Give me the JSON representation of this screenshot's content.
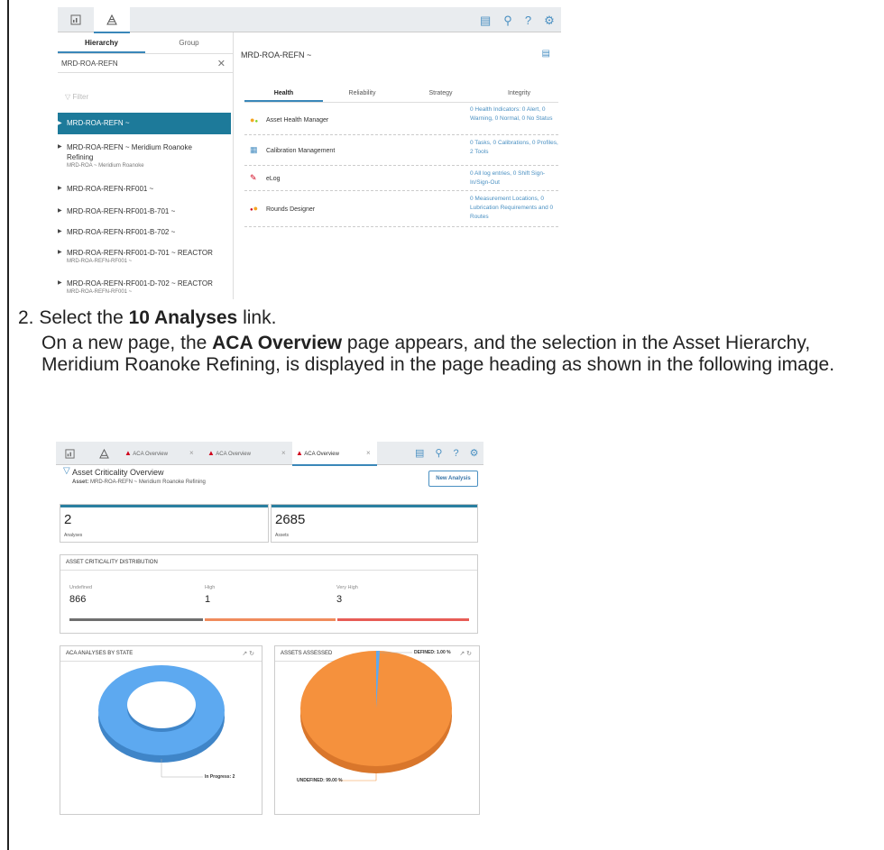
{
  "screenshot1": {
    "toolbar": {
      "icons": [
        "dashboard-icon",
        "hierarchy-icon",
        "document-icon",
        "search-icon",
        "help-icon",
        "settings-icon"
      ],
      "help_glyph": "?"
    },
    "left": {
      "tabs": [
        "Hierarchy",
        "Group"
      ],
      "search_value": "MRD-ROA-REFN",
      "filter_placeholder": "Filter",
      "items": [
        {
          "label": "MRD-ROA-REFN ~",
          "sub": ""
        },
        {
          "label": "MRD-ROA-REFN ~ Meridium Roanoke Refining",
          "sub": "MRD-ROA ~ Meridium Roanoke"
        },
        {
          "label": "MRD-ROA-REFN-RF001 ~",
          "sub": ""
        },
        {
          "label": "MRD-ROA-REFN-RF001-B-701 ~",
          "sub": ""
        },
        {
          "label": "MRD-ROA-REFN-RF001-B-702 ~",
          "sub": ""
        },
        {
          "label": "MRD-ROA-REFN-RF001-D-701 ~ REACTOR",
          "sub": "MRD-ROA-REFN-RF001 ~"
        },
        {
          "label": "MRD-ROA-REFN-RF001-D-702 ~ REACTOR",
          "sub": "MRD-ROA-REFN-RF001 ~"
        }
      ]
    },
    "right": {
      "title": "MRD-ROA-REFN ~",
      "tabs": [
        "Health",
        "Reliability",
        "Strategy",
        "Integrity"
      ],
      "rows": [
        {
          "label": "Asset Health Manager",
          "value": "0 Health Indicators: 0 Alert, 0 Warning, 0 Normal, 0 No Status"
        },
        {
          "label": "Calibration Management",
          "value": "0 Tasks, 0 Calibrations, 0 Profiles, 2 Tools"
        },
        {
          "label": "eLog",
          "value": "0 All log entries, 0 Shift Sign-In/Sign-Out"
        },
        {
          "label": "Rounds Designer",
          "value": "0 Measurement Locations, 0 Lubrication Requirements and 0 Routes"
        }
      ]
    }
  },
  "instruction": {
    "step_number": "2.",
    "step_pre": "Select the ",
    "step_bold": "10 Analyses",
    "step_post": " link.",
    "p_pre": "On a new page, the ",
    "p_bold": "ACA Overview",
    "p_post": " page appears, and the selection in the Asset Hierarchy, Meridium Roanoke Refining, is displayed in the page heading as shown in the following image."
  },
  "screenshot2": {
    "tabs": [
      "ACA Overview",
      "ACA Overview",
      "ACA Overview"
    ],
    "close_glyph": "×",
    "title": "Asset Criticality Overview",
    "asset_label": "Asset:",
    "asset_value": "MRD-ROA-REFN ~ Meridium Roanoke Refining",
    "new_button": "New Analysis",
    "kpis": [
      {
        "value": "2",
        "label": "Analyses"
      },
      {
        "value": "2685",
        "label": "Assets"
      }
    ],
    "distribution": {
      "title": "ASSET CRITICALITY DISTRIBUTION",
      "items": [
        {
          "label": "Undefined",
          "value": "866",
          "color": "#6f6f6f"
        },
        {
          "label": "High",
          "value": "1",
          "color": "#f08b5d"
        },
        {
          "label": "Very High",
          "value": "3",
          "color": "#e75d56"
        }
      ]
    },
    "state_chart": {
      "title": "ACA ANALYSES BY STATE",
      "slices": [
        {
          "label": "In Progress: 2",
          "value": 2,
          "color": "#5da9f0"
        }
      ]
    },
    "assessed_chart": {
      "title": "ASSETS ASSESSED",
      "slices": [
        {
          "label": "DEFINED: 1.00 %",
          "value": 1,
          "color": "#5da9f0"
        },
        {
          "label": "UNDEFINED: 99.00 %",
          "value": 99,
          "color": "#f5913d"
        }
      ]
    }
  }
}
